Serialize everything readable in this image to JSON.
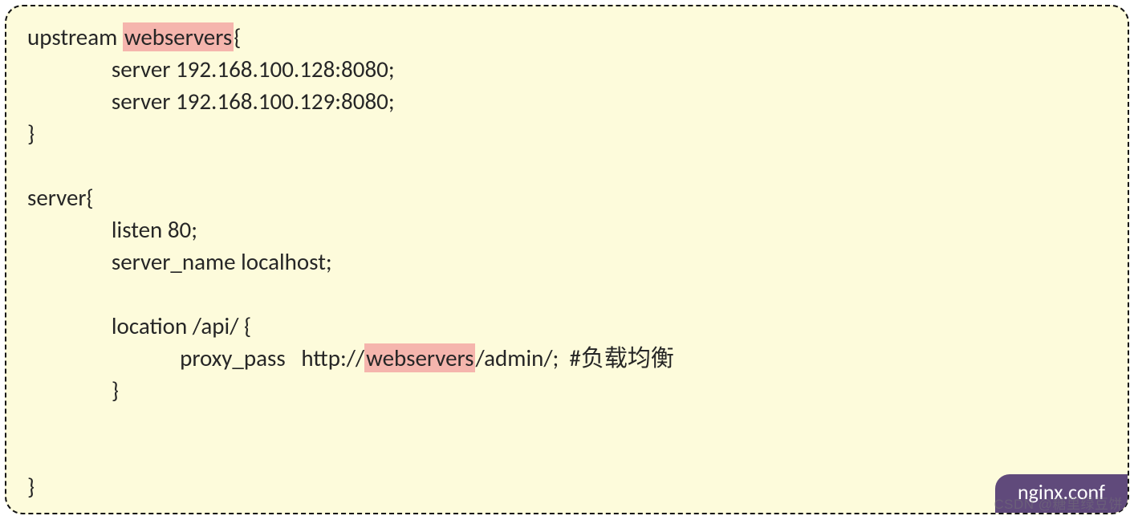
{
  "code": {
    "l1a": "upstream ",
    "l1b": "webservers",
    "l1c": "{",
    "l2": "                server 192.168.100.128:8080;",
    "l3": "                server 192.168.100.129:8080;",
    "l4": "}",
    "l5": "",
    "l6": "server{",
    "l7": "                listen 80;",
    "l8": "                server_name localhost;",
    "l9": "",
    "l10": "                location /api/ {",
    "l11a": "                             proxy_pass   http://",
    "l11b": "webservers",
    "l11c": "/admin/;  #负载均衡",
    "l12": "                }",
    "l13": "",
    "l14": "",
    "l15": "}"
  },
  "badge": "nginx.conf",
  "watermark": "CSDN @糖里绿豆饼"
}
